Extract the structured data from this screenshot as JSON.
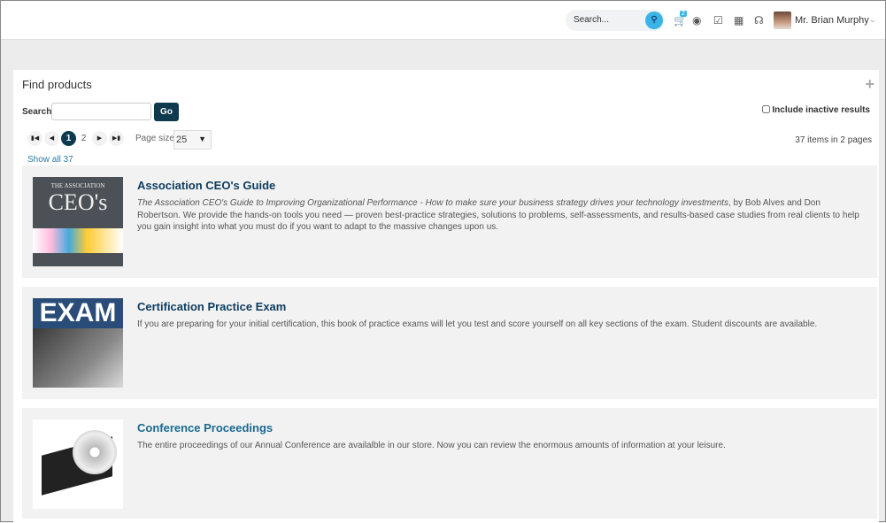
{
  "header": {
    "search_placeholder": "Search...",
    "cart_count": "2",
    "user_name": "Mr. Brian Murphy",
    "icons": [
      "search-icon",
      "cart-icon",
      "robot-icon",
      "checklist-icon",
      "calendar-icon",
      "headset-icon"
    ]
  },
  "panel": {
    "title": "Find products",
    "search_label": "Search",
    "search_value": "",
    "go_label": "Go",
    "include_inactive_label": "Include inactive results",
    "pages": [
      "1",
      "2"
    ],
    "current_page": "1",
    "page_size_label": "Page size:",
    "page_size": "25",
    "items_summary": "37 items in 2 pages",
    "show_all": "Show all 37"
  },
  "products": [
    {
      "title": "Association CEO's Guide",
      "desc_italic": "The Association CEO's Guide to Improving Organizational Performance - How to make sure your business strategy drives your technology investments",
      "desc": ", by Bob Alves and Don Robertson. We provide the hands-on tools you need — proven best-practice strategies, solutions to problems, self-assessments, and results-based case studies from real clients to help you gain insight into what you must do if you want to adapt to the massive changes upon us.",
      "cover_top": "THE ASSOCIATION",
      "cover_main": "CEO's"
    },
    {
      "title": "Certification Practice Exam",
      "desc_italic": "",
      "desc": "If you are preparing for your initial certification, this book of practice exams will let you test and score yourself on all key sections of the exam. Student discounts are available.",
      "cover_main": "EXAM"
    },
    {
      "title": "Conference Proceedings",
      "desc_italic": "",
      "desc": "The entire proceedings of our Annual Conference are availalble in our store. Now you can review the enormous amounts of information at your leisure."
    }
  ]
}
